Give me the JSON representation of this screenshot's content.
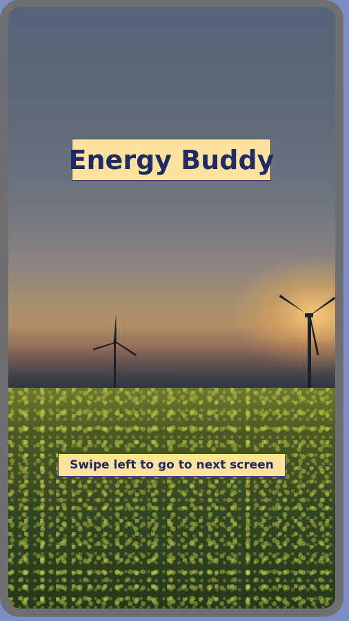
{
  "app": {
    "title": "Energy Buddy",
    "hint": "Swipe left to go to next screen"
  },
  "colors": {
    "label_background": "#fde29d",
    "label_text": "#1f2a66",
    "device_frame": "#6f6f71",
    "page_background": "#7d8fc2"
  },
  "background": {
    "scene": "wind-turbines-over-flower-field-at-sunset"
  }
}
